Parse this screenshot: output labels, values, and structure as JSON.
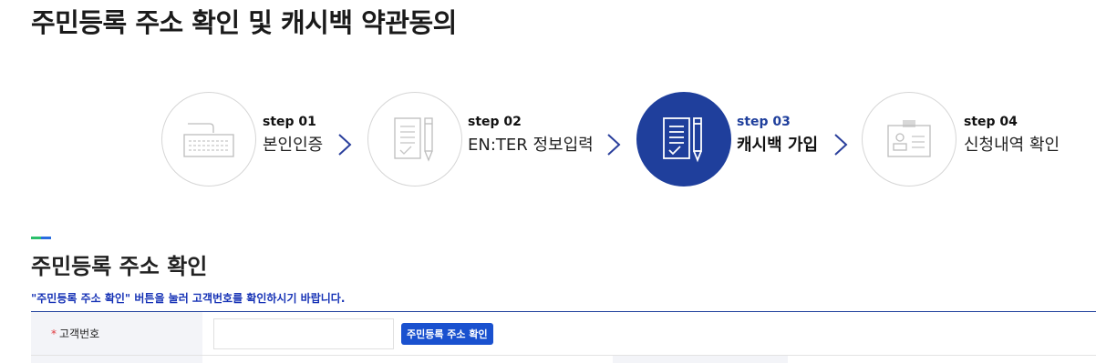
{
  "page_title": "주민등록 주소 확인 및 캐시백 약관동의",
  "steps": [
    {
      "num": "step 01",
      "label": "본인인증",
      "icon": "keyboard-icon",
      "active": false
    },
    {
      "num": "step 02",
      "label": "EN:TER 정보입력",
      "icon": "document-pencil-icon",
      "active": false
    },
    {
      "num": "step 03",
      "label": "캐시백 가입",
      "icon": "document-pencil-icon",
      "active": true
    },
    {
      "num": "step 04",
      "label": "신청내역 확인",
      "icon": "id-card-icon",
      "active": false
    }
  ],
  "colors": {
    "active": "#1f3f9c",
    "notice": "#1733b6",
    "button": "#1a51cf",
    "required": "#e0383e"
  },
  "section": {
    "title": "주민등록 주소 확인"
  },
  "notice": "\"주민등록 주소 확인\" 버튼을 눌러 고객번호를 확인하시기 바랍니다.",
  "form": {
    "required_mark": "*",
    "customer_no_label": "고객번호",
    "customer_no_value": "",
    "confirm_button": "주민등록 주소 확인"
  }
}
